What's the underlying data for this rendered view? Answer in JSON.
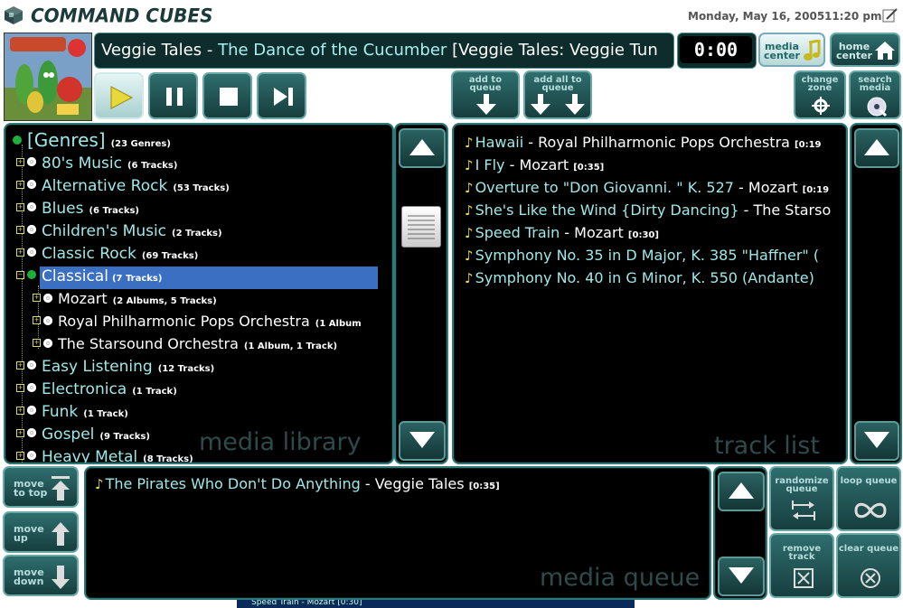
{
  "header": {
    "app_name": "COMMAND CUBES",
    "date": "Monday, May 16, 2005",
    "time": "11:20 pm"
  },
  "now_playing": {
    "artist": "Veggie Tales",
    "separator": " - ",
    "title": "The Dance of the Cucumber",
    "album_suffix": " [Veggie Tales: Veggie Tun",
    "elapsed": "0:00"
  },
  "top_buttons": {
    "media_center": "media center",
    "home_center": "home center",
    "add_to_queue": "add to queue",
    "add_all_to_queue": "add all to queue",
    "change_zone": "change zone",
    "search_media": "search media"
  },
  "library": {
    "watermark": "media library",
    "rows": [
      {
        "label": "[Genres]",
        "count": "(23 Genres)"
      },
      {
        "label": "80's Music",
        "count": "(6 Tracks)"
      },
      {
        "label": "Alternative Rock",
        "count": "(53 Tracks)"
      },
      {
        "label": "Blues",
        "count": "(6 Tracks)"
      },
      {
        "label": "Children's Music",
        "count": "(2 Tracks)"
      },
      {
        "label": "Classic Rock",
        "count": "(69 Tracks)"
      },
      {
        "label": "Classical",
        "count": "(7 Tracks)"
      },
      {
        "label": "Mozart",
        "count": "(2 Albums, 5 Tracks)"
      },
      {
        "label": "Royal Philharmonic Pops Orchestra",
        "count": "(1 Album"
      },
      {
        "label": "The Starsound Orchestra",
        "count": "(1 Album, 1 Track)"
      },
      {
        "label": "Easy Listening",
        "count": "(12 Tracks)"
      },
      {
        "label": "Electronica",
        "count": "(1 Track)"
      },
      {
        "label": "Funk",
        "count": "(1 Track)"
      },
      {
        "label": "Gospel",
        "count": "(9 Tracks)"
      },
      {
        "label": "Heavy Metal",
        "count": "(8 Tracks)"
      }
    ]
  },
  "track_list": {
    "watermark": "track list",
    "tracks": [
      {
        "title": "Hawaii",
        "sep": " - ",
        "artist": "Royal Philharmonic Pops Orchestra",
        "dur": "[0:19"
      },
      {
        "title": "I Fly",
        "sep": " - ",
        "artist": "Mozart",
        "dur": "[0:35]"
      },
      {
        "title": "Overture to \"Don Giovanni. \" K. 527",
        "sep": " - ",
        "artist": "Mozart",
        "dur": "[0:19"
      },
      {
        "title": "She's Like the Wind {Dirty Dancing}",
        "sep": " - ",
        "artist": "The Starso",
        "dur": ""
      },
      {
        "title": "Speed Train",
        "sep": " - ",
        "artist": "Mozart",
        "dur": "[0:30]"
      },
      {
        "title": "Symphony No. 35 in D Major, K. 385 \"Haffner\" (",
        "sep": "",
        "artist": "",
        "dur": ""
      },
      {
        "title": "Symphony No. 40 in G Minor, K. 550 (Andante)",
        "sep": "",
        "artist": "",
        "dur": ""
      }
    ]
  },
  "queue": {
    "watermark": "media queue",
    "items": [
      {
        "title": "The Pirates Who Don't Do Anything",
        "sep": " - ",
        "artist": "Veggie Tales",
        "dur": "[0:35]"
      }
    ],
    "move_to_top": "move to top",
    "move_up": "move up",
    "move_down": "move down",
    "randomize_queue": "randomize queue",
    "loop_queue": "loop queue",
    "remove_track": "remove track",
    "clear_queue": "clear queue"
  },
  "footer_peek": "Speed Train - Mozart [0:30]"
}
